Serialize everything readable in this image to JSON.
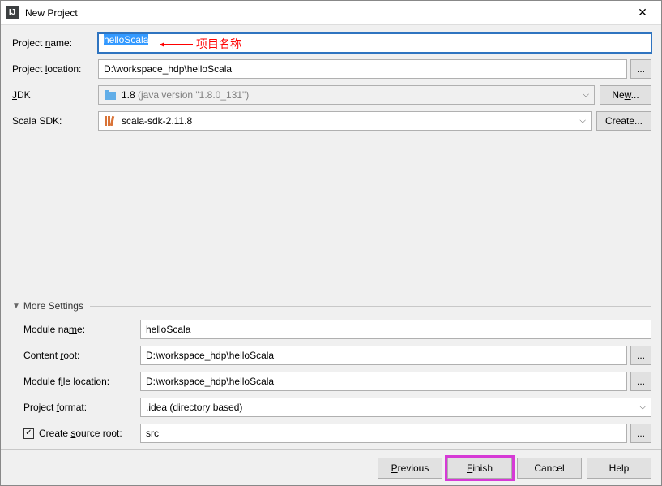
{
  "window": {
    "title": "New Project"
  },
  "fields": {
    "project_name_label": "Project name:",
    "project_name_value": "helloScala",
    "project_location_label": "Project location:",
    "project_location_value": "D:\\workspace_hdp\\helloScala",
    "jdk_label": "JDK",
    "jdk_value_prefix": "1.8",
    "jdk_value_suffix": " (java version \"1.8.0_131\")",
    "jdk_new_btn": "New...",
    "scala_sdk_label": "Scala SDK:",
    "scala_sdk_value": "scala-sdk-2.11.8",
    "scala_sdk_create_btn": "Create..."
  },
  "annotation": {
    "text": "项目名称"
  },
  "more": {
    "header": "More Settings",
    "module_name_label": "Module name:",
    "module_name_value": "helloScala",
    "content_root_label": "Content root:",
    "content_root_value": "D:\\workspace_hdp\\helloScala",
    "module_file_loc_label": "Module file location:",
    "module_file_loc_value": "D:\\workspace_hdp\\helloScala",
    "project_format_label": "Project format:",
    "project_format_value": ".idea (directory based)",
    "create_source_root_label": "Create source root:",
    "create_source_root_value": "src",
    "create_source_root_checked": true
  },
  "buttons": {
    "previous": "Previous",
    "finish": "Finish",
    "cancel": "Cancel",
    "help": "Help",
    "browse": "..."
  }
}
